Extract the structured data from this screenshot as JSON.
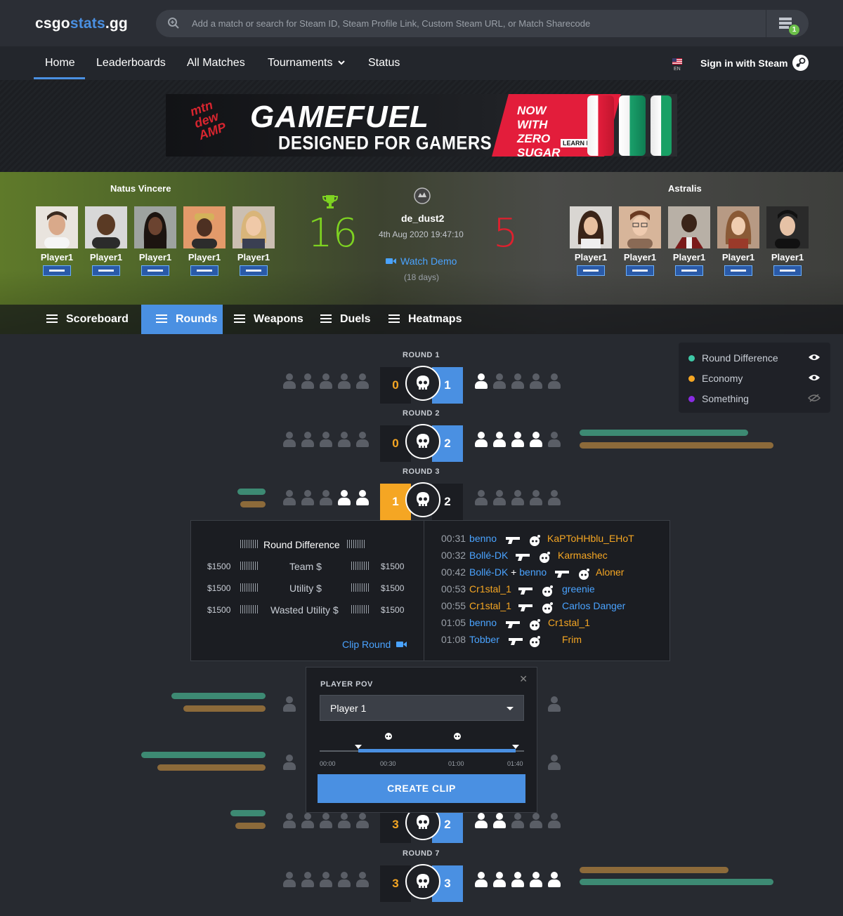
{
  "header": {
    "logo_a": "csgo",
    "logo_b": "stats",
    "logo_c": ".gg",
    "search_placeholder": "Add a match or search for Steam ID, Steam Profile Link, Custom Steam URL, or Match Sharecode",
    "server_badge": "1"
  },
  "nav": {
    "items": [
      "Home",
      "Leaderboards",
      "All Matches",
      "Tournaments",
      "Status"
    ],
    "active": "Home",
    "lang": "EN",
    "signin": "Sign in with Steam"
  },
  "ad": {
    "brand": "mtn dew AMP",
    "headline": "GAMEFUEL",
    "tagline": "DESIGNED FOR GAMERS",
    "promo": "NOW WITH ZERO SUGAR",
    "cta": "LEARN MORE"
  },
  "match": {
    "team_left": "Natus Vincere",
    "team_right": "Astralis",
    "score_left": "16",
    "score_right": "5",
    "map": "de_dust2",
    "datetime": "4th Aug 2020 19:47:10",
    "watch_demo": "Watch Demo",
    "age": "(18 days)",
    "players_left": [
      "Player1",
      "Player1",
      "Player1",
      "Player1",
      "Player1"
    ],
    "players_right": [
      "Player1",
      "Player1",
      "Player1",
      "Player1",
      "Player1"
    ]
  },
  "tabs": [
    "Scoreboard",
    "Rounds",
    "Weapons",
    "Duels",
    "Heatmaps"
  ],
  "rounds": [
    {
      "label": "ROUND 1",
      "left": "0",
      "right": "1"
    },
    {
      "label": "ROUND 2",
      "left": "0",
      "right": "2"
    },
    {
      "label": "ROUND 3",
      "left": "1",
      "right": "2"
    },
    {
      "label": "",
      "left": "3",
      "right": "2"
    },
    {
      "label": "ROUND 7",
      "left": "3",
      "right": "3"
    }
  ],
  "legend": [
    {
      "label": "Round Difference",
      "color": "#3ec9a7"
    },
    {
      "label": "Economy",
      "color": "#f5a623"
    },
    {
      "label": "Something",
      "color": "#8a2be2"
    }
  ],
  "detail": {
    "heading": "Round Difference",
    "rows": [
      {
        "label": "Team $",
        "left": "$1500",
        "right": "$1500"
      },
      {
        "label": "Utility $",
        "left": "$1500",
        "right": "$1500"
      },
      {
        "label": "Wasted Utility $",
        "left": "$1500",
        "right": "$1500"
      }
    ],
    "clip": "Clip Round",
    "kills": [
      {
        "time": "00:31",
        "killer": "benno",
        "victim": "KaPToHHblu_EHoT"
      },
      {
        "time": "00:32",
        "killer": "Bollé-DK",
        "victim": "Karmashec"
      },
      {
        "time": "00:42",
        "killer": "Bollé-DK",
        "assist": "benno",
        "victim": "Aloner"
      },
      {
        "time": "00:53",
        "killer": "Cr1stal_1",
        "victim": "greenie"
      },
      {
        "time": "00:55",
        "killer": "Cr1stal_1",
        "victim": "Carlos Danger"
      },
      {
        "time": "01:05",
        "killer": "benno",
        "victim": "Cr1stal_1"
      },
      {
        "time": "01:08",
        "killer": "Tobber",
        "victim": "Frim"
      }
    ]
  },
  "pov": {
    "title": "PLAYER POV",
    "selected": "Player 1",
    "ticks": [
      "00:00",
      "00:30",
      "01:00",
      "01:40"
    ],
    "button": "CREATE CLIP"
  },
  "colors": {
    "accent": "#4a90e2",
    "ct": "#4a90e2",
    "t": "#f5a623",
    "green": "#3d8a73",
    "brown": "#8c6a3a"
  }
}
